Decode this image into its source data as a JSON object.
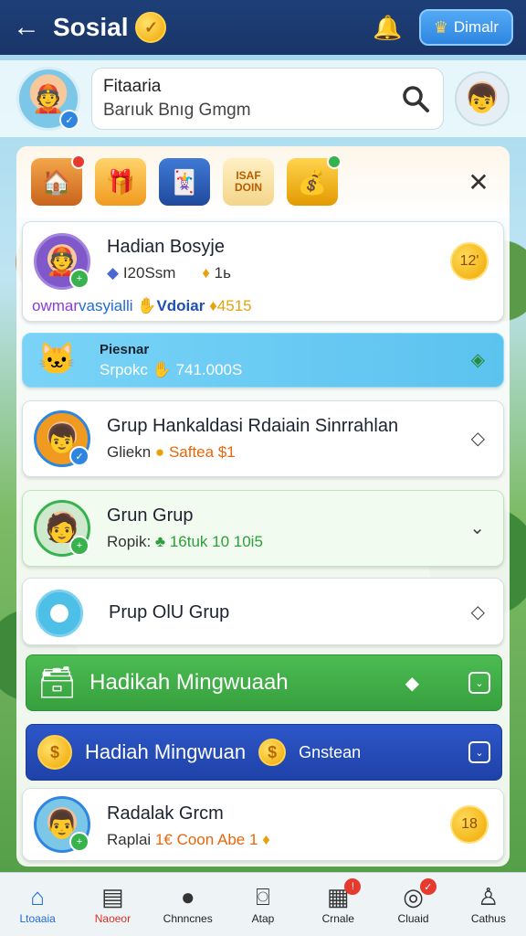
{
  "header": {
    "title": "Sosial",
    "coin_glyph": "✓",
    "bell_icon": "bell-icon",
    "right_button_label": "Dimalr"
  },
  "profile": {
    "search_line1": "Fitaaria",
    "search_line2": "Barıuk Bnıg Gmgm",
    "search_icon": "magnifier-icon"
  },
  "icons": [
    "house-icon",
    "gift-icon",
    "card-icon",
    "coupon-icon",
    "chest-icon"
  ],
  "icon_text": "ISAF\nDOIN",
  "cards": [
    {
      "title": "Hadian Bosyje",
      "meta1": "I20Ssm",
      "meta2": "1ь",
      "extra_purple": "owmar",
      "extra_blue": "vasyialli",
      "extra_vd": "Vdoiar",
      "extra_gold": "4515",
      "badge": "12'"
    },
    {
      "title": "Piesnar",
      "sub1": "Srpokc",
      "sub2": "741.000S"
    },
    {
      "title": "Grup Hankaldasi Rdaiain Sinrrahlan",
      "sub1": "Gliekn",
      "sub2": "Saftea $1"
    },
    {
      "title": "Grun Grup",
      "sub1": "Ropik:",
      "sub2": "16tuk 10 10i5"
    },
    {
      "title": "Prup OlU Grup"
    },
    {
      "title": "Hadikah Mingwuaah"
    },
    {
      "title": "Hadiah Mingwuan",
      "extra": "Gnstean"
    },
    {
      "title": "Radalak Grcm",
      "sub1": "Raplai",
      "sub2": "1€ Coon Abe 1",
      "badge": "18"
    }
  ],
  "nav": [
    {
      "label": "Ltoaaia",
      "icon": "home-icon"
    },
    {
      "label": "Naoeor",
      "icon": "book-icon"
    },
    {
      "label": "Chnncnes",
      "icon": "chat-icon"
    },
    {
      "label": "Atap",
      "icon": "basket-icon"
    },
    {
      "label": "Crnale",
      "icon": "calendar-icon",
      "badge": "!"
    },
    {
      "label": "Cluaid",
      "icon": "gift-icon",
      "badge": "✓"
    },
    {
      "label": "Cathus",
      "icon": "user-icon"
    }
  ],
  "colors": {
    "topbar": "#1d3f78",
    "cyan_card": "#5bc3ef",
    "green_button": "#3fae47",
    "blue_button": "#2248b8",
    "gold": "#f0a800"
  }
}
